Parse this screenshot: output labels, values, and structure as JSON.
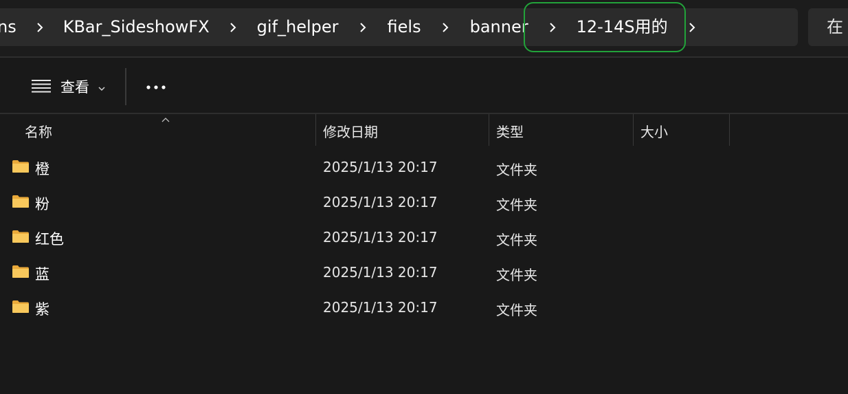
{
  "breadcrumbs": [
    {
      "label": "ns"
    },
    {
      "label": "KBar_SideshowFX"
    },
    {
      "label": "gif_helper"
    },
    {
      "label": "fiels"
    },
    {
      "label": "banner"
    },
    {
      "label": "12-14S用的"
    }
  ],
  "search": {
    "partial_label": "在"
  },
  "toolbar": {
    "view_label": "查看"
  },
  "columns": {
    "name": "名称",
    "date": "修改日期",
    "type": "类型",
    "size": "大小"
  },
  "files": [
    {
      "name": "橙",
      "date": "2025/1/13 20:17",
      "type": "文件夹"
    },
    {
      "name": "粉",
      "date": "2025/1/13 20:17",
      "type": "文件夹"
    },
    {
      "name": "红色",
      "date": "2025/1/13 20:17",
      "type": "文件夹"
    },
    {
      "name": "蓝",
      "date": "2025/1/13 20:17",
      "type": "文件夹"
    },
    {
      "name": "紫",
      "date": "2025/1/13 20:17",
      "type": "文件夹"
    }
  ],
  "colors": {
    "background": "#191919",
    "breadcrumb_bg": "#2b2b2b",
    "highlight_border": "#22a33a",
    "folder_yellow": "#f7c55a"
  },
  "icons": {
    "separator": "chevron-right-icon",
    "view": "list-lines-icon",
    "more": "more-dots-icon",
    "folder": "folder-icon"
  }
}
